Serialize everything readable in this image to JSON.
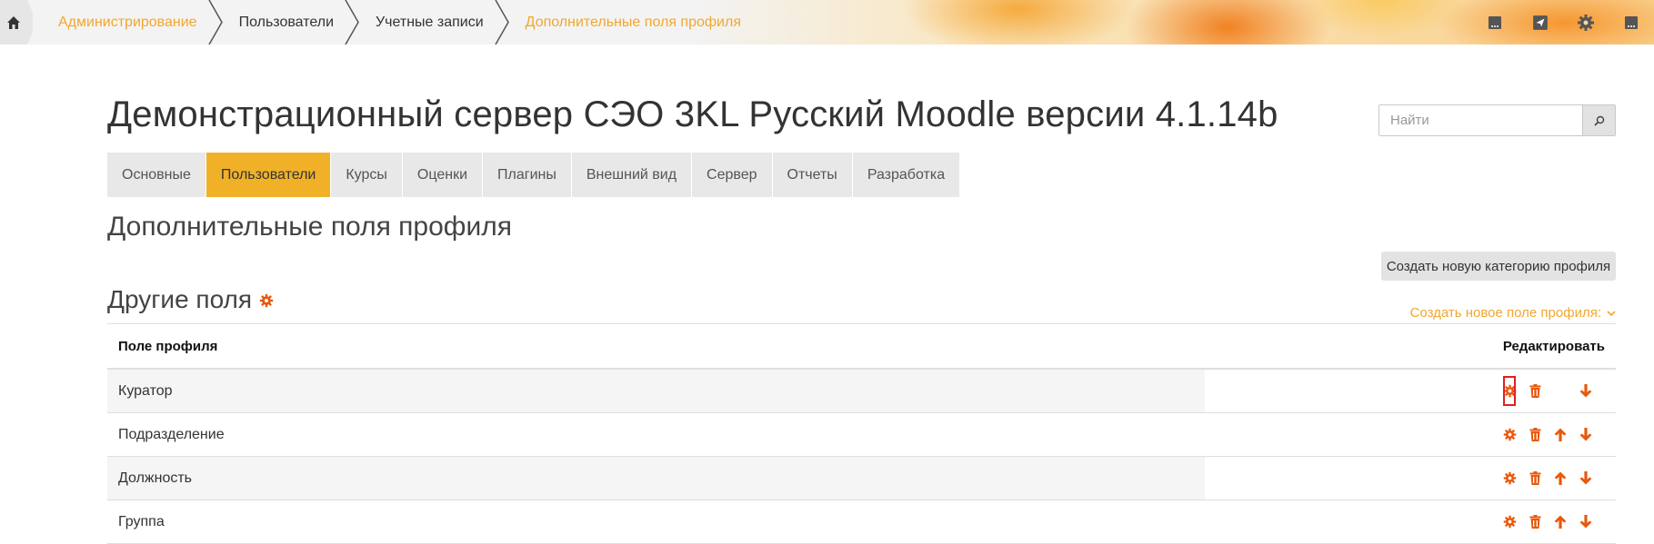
{
  "breadcrumb": {
    "items": [
      {
        "label": "Администрирование",
        "link": true
      },
      {
        "label": "Пользователи",
        "link": false
      },
      {
        "label": "Учетные записи",
        "link": false
      },
      {
        "label": "Дополнительные поля профиля",
        "link": true
      }
    ]
  },
  "header": {
    "site_title": "Демонстрационный сервер СЭО 3KL Русский Moodle версии 4.1.14b",
    "search_placeholder": "Найти"
  },
  "tabs": [
    {
      "label": "Основные",
      "active": false
    },
    {
      "label": "Пользователи",
      "active": true
    },
    {
      "label": "Курсы",
      "active": false
    },
    {
      "label": "Оценки",
      "active": false
    },
    {
      "label": "Плагины",
      "active": false
    },
    {
      "label": "Внешний вид",
      "active": false
    },
    {
      "label": "Сервер",
      "active": false
    },
    {
      "label": "Отчеты",
      "active": false
    },
    {
      "label": "Разработка",
      "active": false
    }
  ],
  "page": {
    "title": "Дополнительные поля профиля",
    "create_category_label": "Создать новую категорию профиля",
    "section_title": "Другие поля",
    "create_field_label": "Создать новое поле профиля:"
  },
  "table": {
    "col_field": "Поле профиля",
    "col_edit": "Редактировать",
    "rows": [
      {
        "name": "Куратор",
        "can_move_up": false,
        "can_move_down": true,
        "highlighted": true
      },
      {
        "name": "Подразделение",
        "can_move_up": true,
        "can_move_down": true,
        "highlighted": false
      },
      {
        "name": "Должность",
        "can_move_up": true,
        "can_move_down": true,
        "highlighted": false
      },
      {
        "name": "Группа",
        "can_move_up": true,
        "can_move_down": true,
        "highlighted": false
      }
    ]
  },
  "colors": {
    "accent": "#f0b129",
    "link": "#f0a830",
    "action_icon": "#e8590c",
    "highlight_box": "#e02020"
  },
  "icons": {
    "home": "home-icon",
    "top": [
      "message-icon",
      "notification-icon",
      "gear-icon",
      "message-icon"
    ],
    "search": "search-icon",
    "edit": "gear-icon",
    "delete": "trash-icon",
    "up": "arrow-up-icon",
    "down": "arrow-down-icon"
  }
}
